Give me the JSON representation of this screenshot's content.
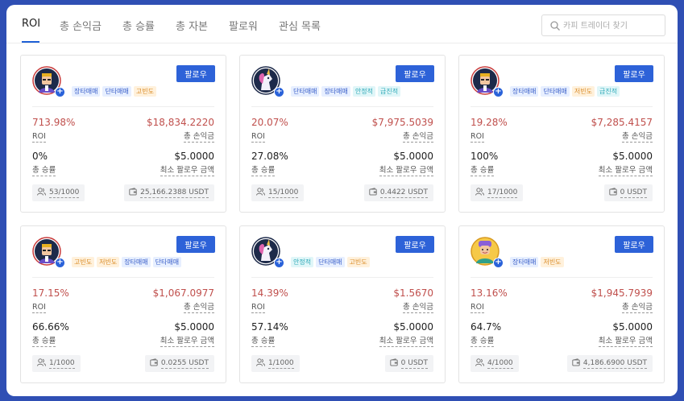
{
  "tabs": [
    "ROI",
    "총 손익금",
    "총 승률",
    "총 자본",
    "팔로워",
    "관심 목록"
  ],
  "search": {
    "placeholder": "카피 트레이더 찾기"
  },
  "labels": {
    "roi": "ROI",
    "total_pnl": "총 손익금",
    "win_rate": "총 승률",
    "min_follow": "최소 팔로우 금액",
    "follow_button": "팔로우"
  },
  "cards": [
    {
      "avatar": "trader-avatar-icon",
      "tags": [
        {
          "text": "장타매매",
          "color": "blue"
        },
        {
          "text": "단타매매",
          "color": "blue"
        },
        {
          "text": "고빈도",
          "color": "orange"
        }
      ],
      "roi": "713.98%",
      "pnl": "$18,834.2220",
      "win_rate": "0%",
      "min_follow": "$5.0000",
      "followers": "53/1000",
      "aum": "25,166.2388 USDT"
    },
    {
      "avatar": "unicorn-avatar-icon",
      "tags": [
        {
          "text": "단타매매",
          "color": "blue"
        },
        {
          "text": "장타매매",
          "color": "blue"
        },
        {
          "text": "안정적",
          "color": "cyan"
        },
        {
          "text": "급진적",
          "color": "cyan"
        }
      ],
      "roi": "20.07%",
      "pnl": "$7,975.5039",
      "win_rate": "27.08%",
      "min_follow": "$5.0000",
      "followers": "15/1000",
      "aum": "0.4422 USDT"
    },
    {
      "avatar": "trader-avatar-icon",
      "tags": [
        {
          "text": "장타매매",
          "color": "blue"
        },
        {
          "text": "단타매매",
          "color": "blue"
        },
        {
          "text": "저빈도",
          "color": "orange"
        },
        {
          "text": "급진적",
          "color": "cyan"
        }
      ],
      "roi": "19.28%",
      "pnl": "$7,285.4157",
      "win_rate": "100%",
      "min_follow": "$5.0000",
      "followers": "17/1000",
      "aum": "0 USDT"
    },
    {
      "avatar": "trader-avatar-icon",
      "tags": [
        {
          "text": "고빈도",
          "color": "orange"
        },
        {
          "text": "저빈도",
          "color": "orange"
        },
        {
          "text": "장타매매",
          "color": "blue"
        },
        {
          "text": "단타매매",
          "color": "blue"
        }
      ],
      "roi": "17.15%",
      "pnl": "$1,067.0977",
      "win_rate": "66.66%",
      "min_follow": "$5.0000",
      "followers": "1/1000",
      "aum": "0.0255 USDT"
    },
    {
      "avatar": "unicorn-avatar-icon",
      "tags": [
        {
          "text": "안정적",
          "color": "cyan"
        },
        {
          "text": "단타매매",
          "color": "blue"
        },
        {
          "text": "고빈도",
          "color": "orange"
        }
      ],
      "roi": "14.39%",
      "pnl": "$1.5670",
      "win_rate": "57.14%",
      "min_follow": "$5.0000",
      "followers": "1/1000",
      "aum": "0 USDT"
    },
    {
      "avatar": "smiling-avatar-icon",
      "tags": [
        {
          "text": "장타매매",
          "color": "blue"
        },
        {
          "text": "저빈도",
          "color": "orange"
        }
      ],
      "roi": "13.16%",
      "pnl": "$1,945.7939",
      "win_rate": "64.7%",
      "min_follow": "$5.0000",
      "followers": "4/1000",
      "aum": "4,186.6900 USDT"
    }
  ]
}
